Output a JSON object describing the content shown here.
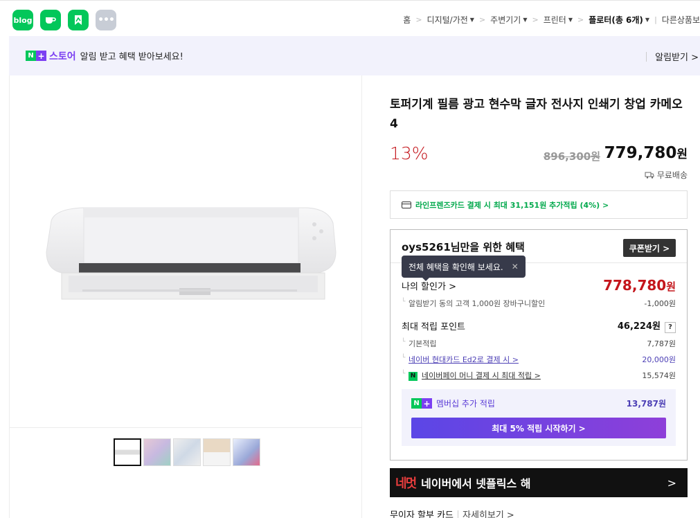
{
  "apps": [
    {
      "label": "blog"
    },
    {
      "label": ""
    },
    {
      "label": ""
    },
    {
      "label": "•••"
    }
  ],
  "breadcrumb": {
    "home": "홈",
    "items": [
      "디지털/가전",
      "주변기기",
      "프린터"
    ],
    "current": "플로터(총 6개)",
    "other": "다른상품보"
  },
  "banner": {
    "n": "N",
    "plus": "+",
    "store": "스토어",
    "text": "알림 받고 혜택 받아보세요!",
    "action": "알림받기 >"
  },
  "product": {
    "title": "토퍼기계 필름 광고 현수막 글자 전사지 인쇄기 창업 카메오4",
    "discount": "13%",
    "original_price": "896,300원",
    "sale_price": "779,780",
    "sale_unit": "원",
    "shipping": "무료배송"
  },
  "card_promo": {
    "text": "라인프렌즈카드 결제 시 최대 31,151원 추가적립 (4%) >"
  },
  "benefits": {
    "heading": "oys5261님만을 위한 혜택",
    "coupon_button": "쿠폰받기 >",
    "tooltip": "전체 혜택을 확인해 보세요.",
    "tooltip_close": "✕",
    "my_price_label": "나의 할인가 >",
    "my_price_value": "778,780",
    "my_price_unit": "원",
    "alarm_label": "알림받기 동의 고객 1,000원 장바구니할인",
    "alarm_value": "-1,000원",
    "max_points_label": "최대 적립 포인트",
    "max_points_value": "46,224원",
    "qmark": "?",
    "basic_label": "기본적립",
    "basic_value": "7,787원",
    "card_label": "네이버 현대카드 Ed2로 결제 시 >",
    "card_value": "20,000원",
    "pay_icon": "N",
    "pay_label": "네이버페이 머니 결제 시 최대 적립 >",
    "pay_value": "15,574원"
  },
  "membership": {
    "n": "N",
    "plus": "+",
    "label": "멤버십 추가 적립",
    "value": "13,787원",
    "button": "최대 5% 적립 시작하기 >"
  },
  "netflix": {
    "logo_a": "네",
    "logo_b": "멋",
    "text": "네이버에서 넷플릭스 해",
    "arrow": ">"
  },
  "installment": {
    "label": "무이자 할부 카드",
    "detail": "자세히보기 >"
  }
}
